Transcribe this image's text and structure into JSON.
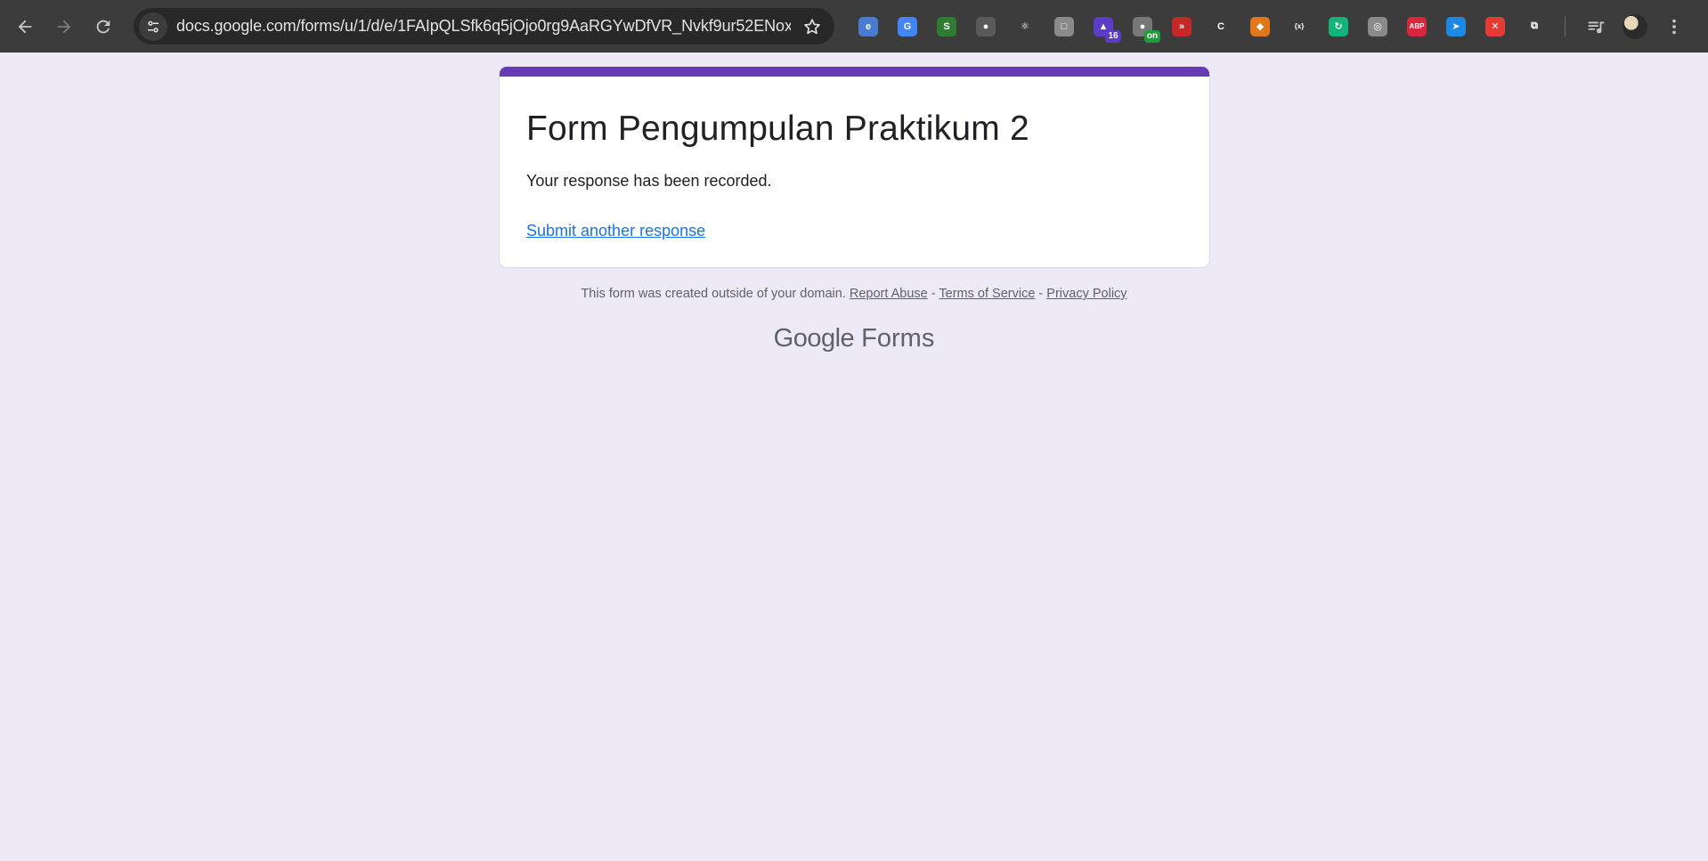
{
  "browser": {
    "url": "docs.google.com/forms/u/1/d/e/1FAIpQLSfk6q5jOjo0rg9AaRGYwDfVR_Nvkf9ur52ENox...",
    "extensions": [
      {
        "icon": "extension-e-icon",
        "color": "#4a7bd0",
        "glyph": "e"
      },
      {
        "icon": "google-translate-icon",
        "color": "#4285f4",
        "glyph": "G"
      },
      {
        "icon": "extension-green-swirl-icon",
        "color": "#2e7d32",
        "glyph": "S"
      },
      {
        "icon": "extension-spy-icon",
        "color": "#5a5a5a",
        "glyph": "●"
      },
      {
        "icon": "react-devtools-icon",
        "color": "#3c3c3c",
        "glyph": "⚛"
      },
      {
        "icon": "extension-gray-card-icon",
        "color": "#8a8a8a",
        "glyph": "□"
      },
      {
        "icon": "extension-purple-icon",
        "color": "#5b3cc4",
        "glyph": "▲",
        "badge": "16",
        "badge_color": "#5b3cc4"
      },
      {
        "icon": "extension-toggle-icon",
        "color": "#777777",
        "glyph": "●",
        "badge": "on",
        "badge_color": "#1e9e3a"
      },
      {
        "icon": "extension-red-forward-icon",
        "color": "#c62828",
        "glyph": "»"
      },
      {
        "icon": "extension-c-icon",
        "color": "#3c3c3c",
        "glyph": "C"
      },
      {
        "icon": "metamask-fox-icon",
        "color": "#e2761b",
        "glyph": "◆"
      },
      {
        "icon": "extension-braces-icon",
        "color": "#3c3c3c",
        "glyph": "{x}"
      },
      {
        "icon": "extension-green-refresh-icon",
        "color": "#13b37a",
        "glyph": "↻"
      },
      {
        "icon": "globe-icon",
        "color": "#8a8a8a",
        "glyph": "◎"
      },
      {
        "icon": "adblock-plus-icon",
        "color": "#d7263d",
        "glyph": "ABP"
      },
      {
        "icon": "extension-blue-share-icon",
        "color": "#1e88e5",
        "glyph": "➤"
      },
      {
        "icon": "extension-red-block-icon",
        "color": "#e53935",
        "glyph": "✕"
      },
      {
        "icon": "puzzle-piece-icon",
        "color": "#3c3c3c",
        "glyph": "⧉"
      }
    ]
  },
  "form": {
    "title": "Form Pengumpulan Praktikum 2",
    "message": "Your response has been recorded.",
    "link": "Submit another response"
  },
  "footer": {
    "note": "This form was created outside of your domain.",
    "report_abuse": "Report Abuse",
    "sep1": "-",
    "terms": "Terms of Service",
    "sep2": "-",
    "privacy": "Privacy Policy"
  },
  "brand": {
    "google": "Google",
    "forms": "Forms"
  },
  "colors": {
    "page_bg": "#ede9f7",
    "accent": "#673ab7",
    "link": "#1a73e8",
    "toolbar_bg": "#3c3c3c"
  }
}
